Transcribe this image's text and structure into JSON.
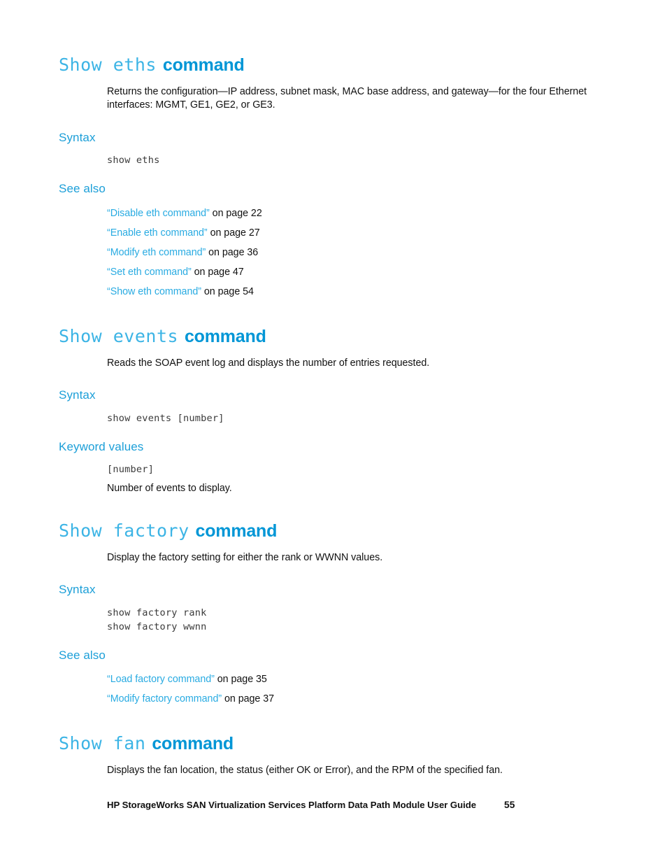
{
  "document": {
    "page_number": "55",
    "footer_text": "HP StorageWorks SAN Virtualization Services Platform Data Path Module User Guide"
  },
  "colors": {
    "heading_mono": "#3cb4e5",
    "heading_word": "#0096d6",
    "subheading": "#1c9fd8",
    "link": "#29abe2",
    "body": "#111111",
    "code": "#3a3a3a"
  },
  "sections": [
    {
      "heading_command": "Show eths",
      "heading_word": "command",
      "description": "Returns the configuration—IP address, subnet mask, MAC base address, and gateway—for the four Ethernet interfaces: MGMT, GE1, GE2, or GE3.",
      "syntax_label": "Syntax",
      "syntax_lines": [
        "show eths"
      ],
      "see_also_label": "See also",
      "see_also": [
        {
          "link": "“Disable eth command”",
          "tail": " on page 22"
        },
        {
          "link": "“Enable eth command”",
          "tail": " on page 27"
        },
        {
          "link": "“Modify eth command”",
          "tail": " on page 36"
        },
        {
          "link": "“Set eth command”",
          "tail": " on page 47"
        },
        {
          "link": "“Show eth command”",
          "tail": " on page 54"
        }
      ]
    },
    {
      "heading_command": "Show events",
      "heading_word": "command",
      "description": "Reads the SOAP event log and displays the number of entries requested.",
      "syntax_label": "Syntax",
      "syntax_lines": [
        "show events [number]"
      ],
      "keyword_values_label": "Keyword values",
      "keyword_code": "[number]",
      "keyword_description": "Number of events to display."
    },
    {
      "heading_command": "Show factory",
      "heading_word": "command",
      "description": "Display the factory setting for either the rank or WWNN values.",
      "syntax_label": "Syntax",
      "syntax_lines": [
        "show factory rank",
        "show factory wwnn"
      ],
      "see_also_label": "See also",
      "see_also": [
        {
          "link": "“Load factory command”",
          "tail": " on page 35"
        },
        {
          "link": "“Modify factory command”",
          "tail": " on page 37"
        }
      ]
    },
    {
      "heading_command": "Show fan",
      "heading_word": "command",
      "description": "Displays the fan location, the status (either OK or Error), and the RPM of the specified fan."
    }
  ]
}
